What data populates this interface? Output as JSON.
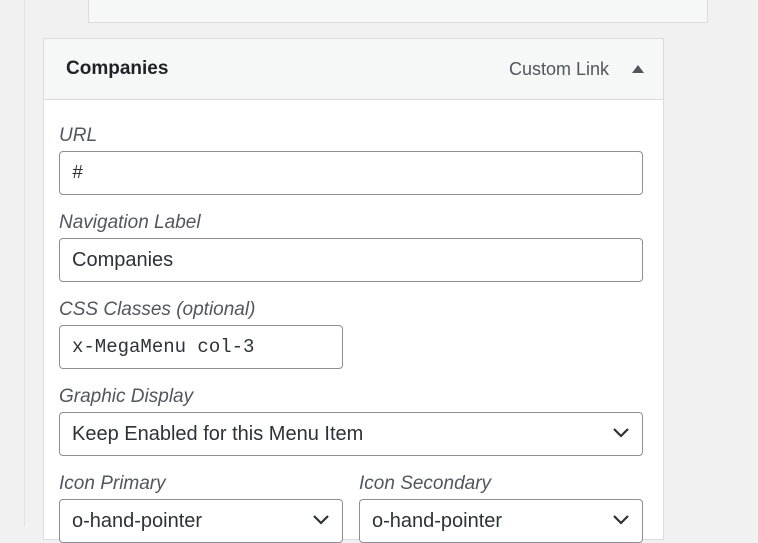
{
  "previous_item": {},
  "menu_item": {
    "title": "Companies",
    "type": "Custom Link"
  },
  "fields": {
    "url": {
      "label": "URL",
      "value": "#"
    },
    "nav_label": {
      "label": "Navigation Label",
      "value": "Companies"
    },
    "css_classes": {
      "label": "CSS Classes (optional)",
      "value": "x-MegaMenu col-3"
    },
    "graphic_display": {
      "label": "Graphic Display",
      "value": "Keep Enabled for this Menu Item"
    },
    "icon_primary": {
      "label": "Icon Primary",
      "value": "o-hand-pointer"
    },
    "icon_secondary": {
      "label": "Icon Secondary",
      "value": "o-hand-pointer"
    }
  },
  "icons": {
    "toggle": "arrow-up-icon",
    "select": "chevron-down-icon"
  },
  "colors": {
    "border": "#dcdcde",
    "input_border": "#8c8f94",
    "label": "#50575e",
    "title": "#1d2327"
  }
}
